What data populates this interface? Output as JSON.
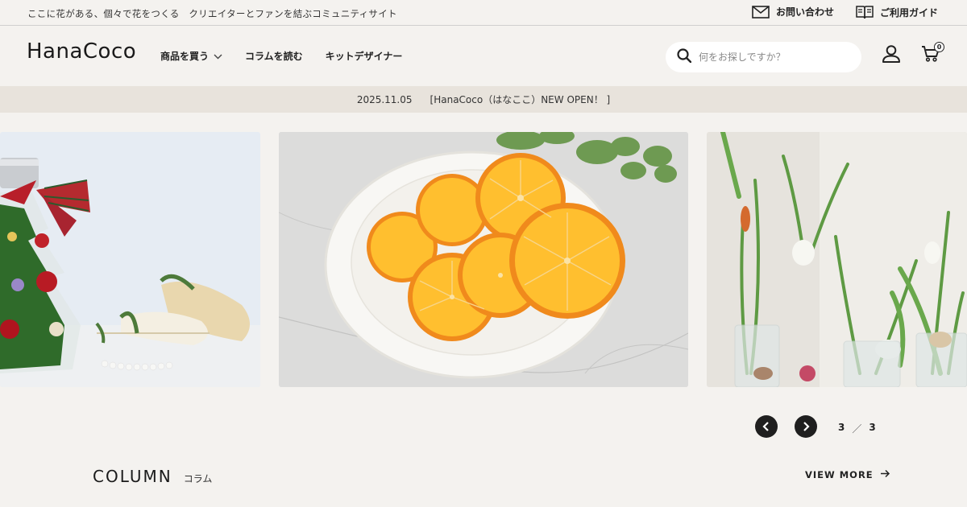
{
  "topbar": {
    "tagline": "ここに花がある、個々で花をつくる　クリエイターとファンを結ぶコミュニティサイト",
    "contact_label": "お問い合わせ",
    "guide_label": "ご利用ガイド"
  },
  "header": {
    "logo": "HanaCoco",
    "nav": [
      {
        "label": "商品を買う",
        "icon": "chevron-down-icon"
      },
      {
        "label": "コラムを読む"
      },
      {
        "label": "キットデザイナー"
      }
    ],
    "search_placeholder": "何をお探しですか？",
    "cart_count": "0"
  },
  "news": {
    "date": "2025.11.05",
    "text": "[HanaCoco（はなここ）NEW OPEN！ ]"
  },
  "slider": {
    "slides": [
      {
        "alt": "クリスマスツリーボトル"
      },
      {
        "alt": "ドライオレンジ"
      },
      {
        "alt": "球根の花"
      }
    ],
    "current": "3",
    "separator": "／",
    "total": "3"
  },
  "column": {
    "title_en": "COLUMN",
    "title_ja": "コラム",
    "view_more": "VIEW MORE"
  },
  "colors": {
    "background": "#f4f2ef",
    "newsbar": "#e8e3dc",
    "dark": "#1f1f1f",
    "orange": "#f5a623"
  }
}
